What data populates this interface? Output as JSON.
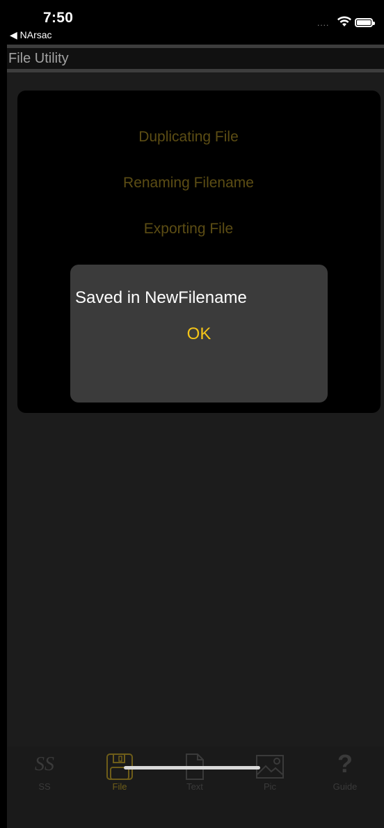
{
  "status_bar": {
    "time": "7:50",
    "back_app": "◀ NArsac",
    "signal": "....",
    "icons": [
      "wifi-icon",
      "battery-icon"
    ]
  },
  "nav": {
    "title": "File Utility"
  },
  "menu": {
    "items": [
      "Duplicating File",
      "Renaming Filename",
      "Exporting File"
    ]
  },
  "alert": {
    "message": "Saved in NewFilename",
    "ok_label": "OK"
  },
  "tabs": [
    {
      "label": "SS",
      "glyph": "SS",
      "icon": "ss-icon",
      "active": false
    },
    {
      "label": "File",
      "icon": "floppy-disk-icon",
      "active": true
    },
    {
      "label": "Text",
      "icon": "document-icon",
      "active": false
    },
    {
      "label": "Pic",
      "icon": "picture-icon",
      "active": false
    },
    {
      "label": "Guide",
      "glyph": "?",
      "icon": "question-icon",
      "active": false
    }
  ],
  "colors": {
    "background": "#1c1c1c",
    "panel": "#000000",
    "menu_text": "#5c4d14",
    "alert_bg": "#3b3b3b",
    "accent": "#f5c518"
  }
}
